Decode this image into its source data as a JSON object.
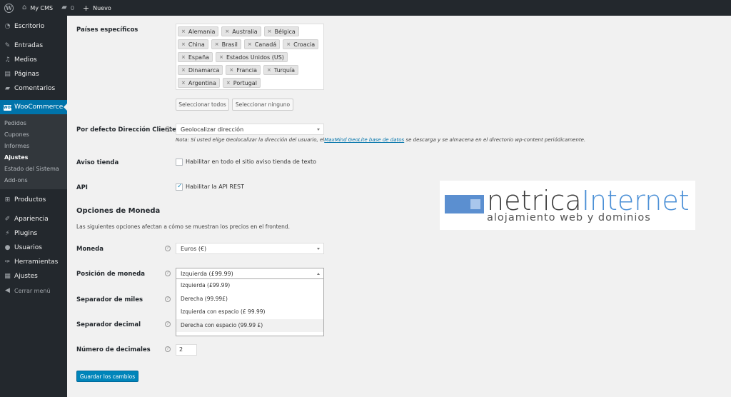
{
  "adminbar": {
    "site_name": "My CMS",
    "comments_count": "0",
    "new_label": "Nuevo"
  },
  "sidebar": {
    "items": [
      {
        "label": "Escritorio",
        "icon": "dashboard-icon"
      },
      {
        "label": "Entradas",
        "icon": "pin-icon"
      },
      {
        "label": "Medios",
        "icon": "media-icon"
      },
      {
        "label": "Páginas",
        "icon": "page-icon"
      },
      {
        "label": "Comentarios",
        "icon": "comment-icon"
      },
      {
        "label": "WooCommerce",
        "icon": "woocommerce-icon"
      }
    ],
    "submenu": [
      "Pedidos",
      "Cupones",
      "Informes",
      "Ajustes",
      "Estado del Sistema",
      "Add-ons"
    ],
    "items2": [
      {
        "label": "Productos",
        "icon": "cart-icon"
      },
      {
        "label": "Apariencia",
        "icon": "brush-icon"
      },
      {
        "label": "Plugins",
        "icon": "plugin-icon"
      },
      {
        "label": "Usuarios",
        "icon": "user-icon"
      },
      {
        "label": "Herramientas",
        "icon": "wrench-icon"
      },
      {
        "label": "Ajustes",
        "icon": "settings-icon"
      }
    ],
    "collapse_label": "Cerrar menú",
    "accent_color": "#0073aa"
  },
  "settings": {
    "countries_label": "Países específicos",
    "countries": [
      [
        "Alemania",
        "Australia",
        "Bélgica"
      ],
      [
        "China",
        "Brasil",
        "Canadá",
        "Croacia"
      ],
      [
        "España",
        "Estados Unidos (US)"
      ],
      [
        "Dinamarca",
        "Francia",
        "Turquía"
      ],
      [
        "Argentina",
        "Portugal"
      ]
    ],
    "select_all": "Seleccionar todos",
    "select_none": "Seleccionar ninguno",
    "default_address_label": "Por defecto Dirección Cliente",
    "default_address_value": "Geolocalizar dirección",
    "note_prefix": "Nota: Si usted elige Geolocalizar la dirección del usuario, el",
    "note_link": "MaxMind GeoLite base de datos",
    "note_suffix": " se descarga y se almacena en el directorio wp-content periódicamente.",
    "store_notice_label": "Aviso tienda",
    "store_notice_checkbox": "Habilitar en todo el sitio aviso tienda de texto",
    "store_notice_checked": false,
    "api_label": "API",
    "api_checkbox": "Habilitar la API REST",
    "api_checked": true,
    "currency_section_title": "Opciones de Moneda",
    "currency_section_desc": "Las siguientes opciones afectan a cómo se muestran los precios en el frontend.",
    "currency_label": "Moneda",
    "currency_value": "Euros (€)",
    "position_label": "Posición de moneda",
    "position_value": "Izquierda (£99.99)",
    "position_options": [
      "Izquierda (£99.99)",
      "Derecha (99.99£)",
      "Izquierda con espacio (£ 99.99)",
      "Derecha con espacio (99.99 £)"
    ],
    "thousand_sep_label": "Separador de miles",
    "decimal_sep_label": "Separador decimal",
    "decimals_label": "Número de decimales",
    "decimals_value": "2",
    "save_button": "Guardar los cambios"
  },
  "watermark": {
    "brand_part1": "netrica",
    "brand_part2": "Internet",
    "tagline": "alojamiento web y dominios"
  }
}
